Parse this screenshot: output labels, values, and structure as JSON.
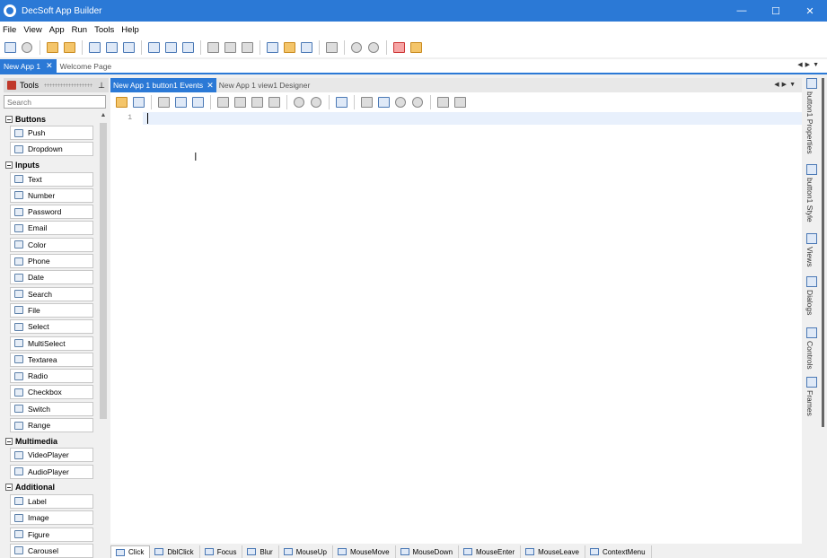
{
  "window": {
    "title": "DecSoft App Builder",
    "controls": {
      "minimize": "—",
      "maximize": "☐",
      "close": "✕"
    }
  },
  "menu": [
    "File",
    "View",
    "App",
    "Run",
    "Tools",
    "Help"
  ],
  "doc_tabs": [
    {
      "label": "New App 1",
      "active": true,
      "close": "✕"
    },
    {
      "label": "Welcome Page",
      "active": false
    }
  ],
  "tools_panel": {
    "title": "Tools",
    "search_placeholder": "Search",
    "categories": [
      {
        "name": "Buttons",
        "items": [
          "Push",
          "Dropdown"
        ]
      },
      {
        "name": "Inputs",
        "items": [
          "Text",
          "Number",
          "Password",
          "Email",
          "Color",
          "Phone",
          "Date",
          "Search",
          "File",
          "Select",
          "MultiSelect",
          "Textarea",
          "Radio",
          "Checkbox",
          "Switch",
          "Range"
        ]
      },
      {
        "name": "Multimedia",
        "items": [
          "VideoPlayer",
          "AudioPlayer"
        ]
      },
      {
        "name": "Additional",
        "items": [
          "Label",
          "Image",
          "Figure",
          "Carousel"
        ]
      }
    ]
  },
  "editor": {
    "tabs": [
      {
        "label": "New App 1 button1 Events",
        "active": true,
        "close": "✕"
      },
      {
        "label": "New App 1 view1 Designer",
        "active": false
      }
    ],
    "line_number": "1"
  },
  "event_tabs": [
    "Click",
    "DblClick",
    "Focus",
    "Blur",
    "MouseUp",
    "MouseMove",
    "MouseDown",
    "MouseEnter",
    "MouseLeave",
    "ContextMenu"
  ],
  "right_panels": [
    "button1 Properties",
    "button1 Style",
    "Views",
    "Dialogs",
    "Controls",
    "Frames"
  ]
}
